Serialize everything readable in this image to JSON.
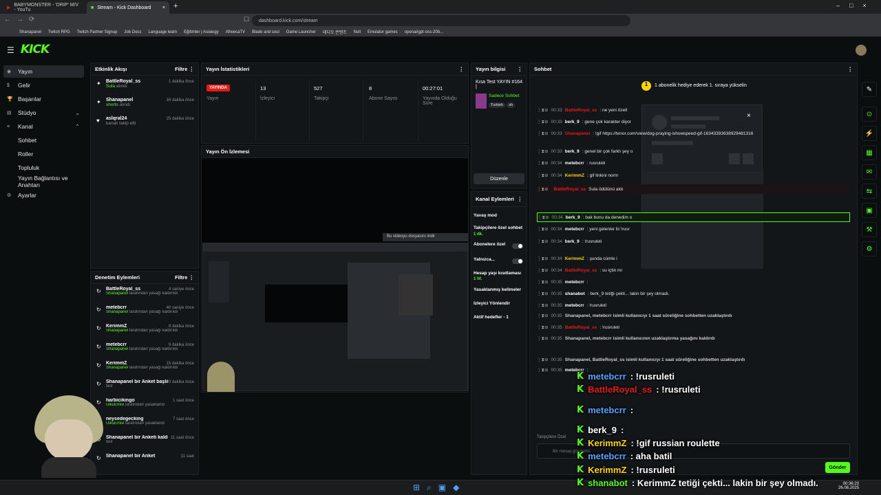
{
  "browser": {
    "tabs": [
      "BABYMONSTER - 'DRIP' M/V - YouTu",
      "Stream - Kick Dashboard"
    ],
    "url": "dashboard.kick.com/stream",
    "bookmarks": [
      "Shanapanel",
      "Twitch RPG",
      "Twitch Partner Signup",
      "Job Docs",
      "Language learn",
      "Eğitimler | Asiaiogy",
      "AfreecaTV",
      "Blade and soul",
      "Game Launcher",
      "테디오 콘텐츠",
      "Null",
      "Emulator games",
      "openai/gpt-oss-20b..."
    ]
  },
  "logo": "KICK",
  "sidebar": [
    {
      "label": "Yayın",
      "active": true
    },
    {
      "label": "Gelir"
    },
    {
      "label": "Başarılar"
    },
    {
      "label": "Stüdyo"
    },
    {
      "label": "Kanal"
    },
    {
      "label": "Sohbet",
      "sub": true
    },
    {
      "label": "Roller",
      "sub": true
    },
    {
      "label": "Topluluk",
      "sub": true
    },
    {
      "label": "Yayın Bağlantısı ve Anahtarı",
      "sub": true
    },
    {
      "label": "Ayarlar"
    }
  ],
  "activity": {
    "title": "Etkinlik Akışı",
    "filter": "Filtre",
    "items": [
      {
        "name": "BattleRoyal_ss",
        "action": "Sula",
        "suffix": "alındı",
        "time": "1 dakika önce"
      },
      {
        "name": "Shanapanel",
        "action": "shorts",
        "suffix": "alındı",
        "time": "16 dakika önce"
      },
      {
        "name": "aslqral24",
        "action": "",
        "suffix": "kanalı takip etti",
        "time": "25 dakika önce"
      }
    ]
  },
  "moderation": {
    "title": "Denetim Eylemleri",
    "filter": "Filtre",
    "items": [
      {
        "name": "BattleRoyal_ss",
        "by": "Shanapanel",
        "text": "tarafından yasağı kaldırıldı",
        "time": "4 saniye önce"
      },
      {
        "name": "metebcrr",
        "by": "Shanapanel",
        "text": "tarafından yasağı kaldırıldı",
        "time": "40 saniye önce"
      },
      {
        "name": "KerimmZ",
        "by": "Shanapanel",
        "text": "tarafından yasağı kaldırıldı",
        "time": "8 dakika önce"
      },
      {
        "name": "metebcrr",
        "by": "Shanapanel",
        "text": "tarafından yasağı kaldırıldı",
        "time": "9 dakika önce"
      },
      {
        "name": "KerimmZ",
        "by": "Shanapanel",
        "text": "tarafından yasağı kaldırıldı",
        "time": "15 dakika önce"
      },
      {
        "name": "Shanapanel bir Anket başlattı",
        "by": "",
        "text": "test",
        "time": "20 dakika önce"
      },
      {
        "name": "harbicikingo",
        "by": "UlkuEmre",
        "text": "tarafından yasaklandı",
        "time": "1 saat önce"
      },
      {
        "name": "neysedegecking",
        "by": "UlkuEmre",
        "text": "tarafından yasaklandı",
        "time": "7 saat önce"
      },
      {
        "name": "Shanapanel bir Anketi kaldırdı",
        "by": "",
        "text": "test",
        "time": "11 saat önce"
      },
      {
        "name": "Shanapanel bir Anket",
        "by": "",
        "text": "",
        "time": "11 saat"
      }
    ]
  },
  "stats": {
    "title": "Yayın İstatistikleri",
    "live": "YAYINDA",
    "live_label": "Yayın",
    "viewers": "13",
    "viewers_label": "İzleyici",
    "followers": "527",
    "followers_label": "Takipçi",
    "subs": "8",
    "subs_label": "Abone Sayısı",
    "uptime": "00:27:01",
    "uptime_label": "Yayında Olduğu Süre"
  },
  "preview": {
    "title": "Yayın Ön İzlemesi",
    "download": "Bu videoyu dosyasını indir"
  },
  "info": {
    "title": "Yayın bilgisi",
    "stream_title": "Kısa Test YAYIN #164 |",
    "category": "Sadece Sohbet",
    "tags": [
      "Turkish",
      "sh"
    ],
    "edit": "Düzenle"
  },
  "actions": {
    "title": "Kanal Eylemleri",
    "items": [
      "Yavaş mod",
      "Takipçilere özel sohbet",
      "Abonelere özel",
      "Yalnızca...",
      "Hesap yaşı kısıtlaması",
      "Yasaklanmış kelimeler",
      "İzleyici Yönlendir",
      "Aktif hedefler - 1"
    ],
    "sub1": "1 dk.",
    "sub2": "1 hf."
  },
  "chat": {
    "title": "Sohbet",
    "banner": "1 abonelik hediye ederek 1. sıraya yükselin",
    "placeholder": "Bir mesaj gönderin",
    "send": "Gönder",
    "followers_only": "Takipçilere Özel",
    "lines": [
      {
        "t": "00:33",
        "u": "BattleRoyal_ss",
        "c": "#e91916",
        "m": ": ne yeni özell"
      },
      {
        "t": "00:33",
        "u": "berk_9",
        "c": "#fff",
        "m": ": gene çok karakter diyor"
      },
      {
        "t": "00:33",
        "u": "Shanapanel",
        "c": "#e91916",
        "m": ": !gif https://tenor.com/view/dog-praying-ishowspeed-gif-16343393638929481316"
      },
      {
        "t": "00:33",
        "u": "berk_9",
        "c": "#fff",
        "m": ": genel bir çok farklı şey o"
      },
      {
        "t": "00:34",
        "u": "metebcrr",
        "c": "#fff",
        "m": ": rusruleti"
      },
      {
        "t": "00:34",
        "u": "KerimmZ",
        "c": "#ffd500",
        "m": ": gif linkini norm"
      },
      {
        "t": "",
        "u": "BattleRoyal_ss",
        "c": "#e91916",
        "m": " Sula ödülünü aldı"
      },
      {
        "t": "00:34",
        "u": "berk_9",
        "c": "#fff",
        "m": ": bak bunu da denedim o"
      },
      {
        "t": "00:34",
        "u": "metebcrr",
        "c": "#fff",
        "m": ": yeni gelenler bi !rusr"
      },
      {
        "t": "00:34",
        "u": "berk_9",
        "c": "#fff",
        "m": ": !rusruleti"
      },
      {
        "t": "00:34",
        "u": "KerimmZ",
        "c": "#ffd500",
        "m": ": şunda cümle i"
      },
      {
        "t": "00:34",
        "u": "BattleRoyal_ss",
        "c": "#e91916",
        "m": ": su içtin mi"
      },
      {
        "t": "00:35",
        "u": "metebcrr",
        "c": "#fff",
        "m": ":"
      },
      {
        "t": "00:35",
        "u": "shanabot",
        "c": "#fff",
        "m": ": berk_9 tetiği çekti... lakin bir şey olmadı."
      },
      {
        "t": "00:35",
        "u": "metebcrr",
        "c": "#fff",
        "m": ": !rusruleti"
      },
      {
        "t": "00:35",
        "u": "",
        "c": "#fff",
        "m": "Shanapanel, metebcrr isimli kullanıcıyı 1 saat süreliğine sohbetten uzaklaştırdı"
      },
      {
        "t": "00:35",
        "u": "BattleRoyal_ss",
        "c": "#e91916",
        "m": ": !rusruleti"
      },
      {
        "t": "00:35",
        "u": "",
        "c": "#fff",
        "m": "Shanapanel, metebcrr isimli kullanıcının uzaklaştırma yasağını kaldırdı"
      },
      {
        "t": "00:35",
        "u": "",
        "c": "#fff",
        "m": "Shanapanel, BattleRoyal_ss isimli kullanıcıyı 1 saat süreliğine sohbetten uzaklaştırdı"
      },
      {
        "t": "00:35",
        "u": "metebcrr",
        "c": "#fff",
        "m": ":"
      }
    ]
  },
  "overlay": [
    {
      "u": "metebcrr",
      "c": "#53a3fc",
      "m": ": !rusruleti"
    },
    {
      "u": "BattleRoyal_ss",
      "c": "#e91916",
      "m": ": !rusruleti"
    },
    {
      "u": "metebcrr",
      "c": "#53a3fc",
      "m": ":"
    },
    {
      "u": "berk_9",
      "c": "#fff",
      "m": ":"
    },
    {
      "u": "KerimmZ",
      "c": "#ffd500",
      "m": ": !gif russian roulette"
    },
    {
      "u": "metebcrr",
      "c": "#53a3fc",
      "m": ": aha batil"
    },
    {
      "u": "KerimmZ",
      "c": "#ffd500",
      "m": ": !rusruleti"
    },
    {
      "u": "shanabot",
      "c": "#53fc18",
      "m": ": KerimmZ tetiği çekti... lakin bir şey olmadı."
    }
  ],
  "clock": {
    "time": "00:36:20",
    "date": "26.08.2025"
  },
  "colors": {
    "accent": "#53fc18",
    "live": "#e91916"
  }
}
